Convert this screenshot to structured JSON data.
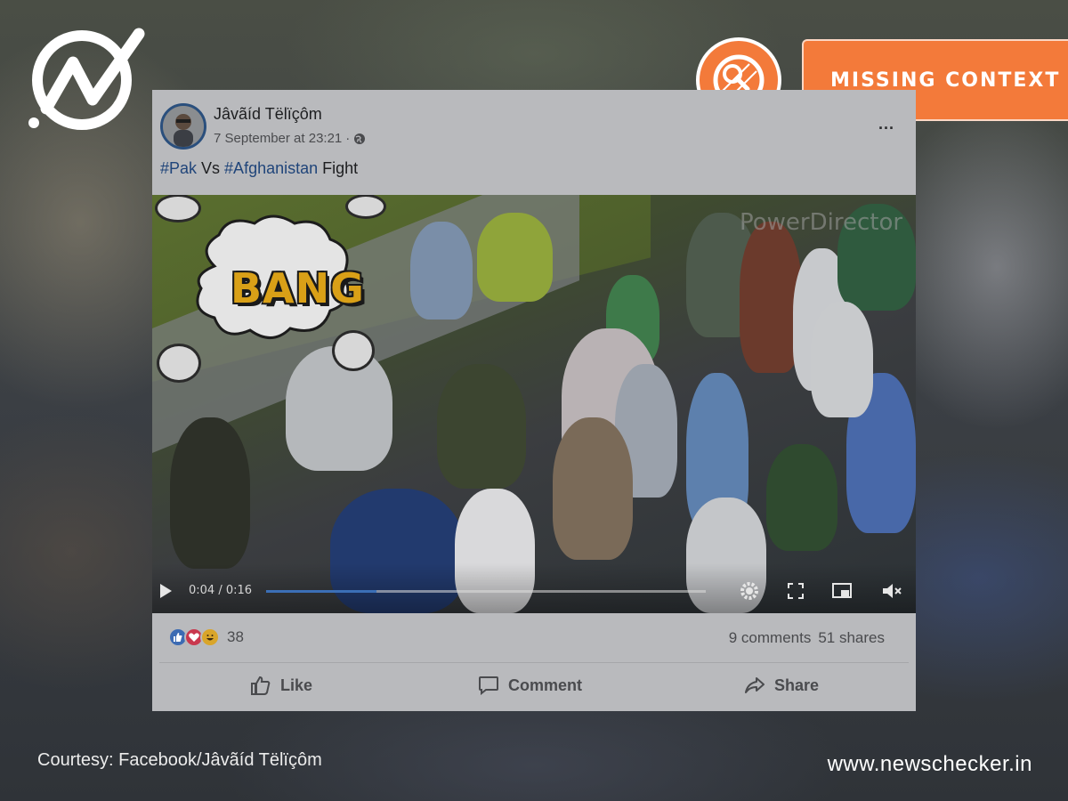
{
  "badge": {
    "label": "MISSING CONTEXT",
    "color": "#f37a3a"
  },
  "post": {
    "author": "Jâvãíd Tëlïçôm",
    "timestamp": "7 September at 23:21",
    "audience_icon": "globe-icon",
    "more_label": "...",
    "text": {
      "hashtag1": "#Pak",
      "mid": " Vs ",
      "hashtag2": "#Afghanistan",
      "tail": " Fight"
    },
    "video": {
      "overlay_text": "BANG",
      "time": "0:04 / 0:16",
      "progress": 0.25,
      "watermark": "PowerDirector"
    },
    "reactions": {
      "icons": [
        "like-icon",
        "love-icon",
        "haha-icon"
      ],
      "count": "38"
    },
    "comments": "9 comments",
    "shares": "51 shares",
    "actions": {
      "like": "Like",
      "comment": "Comment",
      "share": "Share"
    }
  },
  "footer": {
    "courtesy": "Courtesy: Facebook/Jâvãíd Tëlïçôm",
    "site": "www.newschecker.in"
  },
  "colors": {
    "link": "#20457a",
    "progress": "#3b6fb6"
  }
}
